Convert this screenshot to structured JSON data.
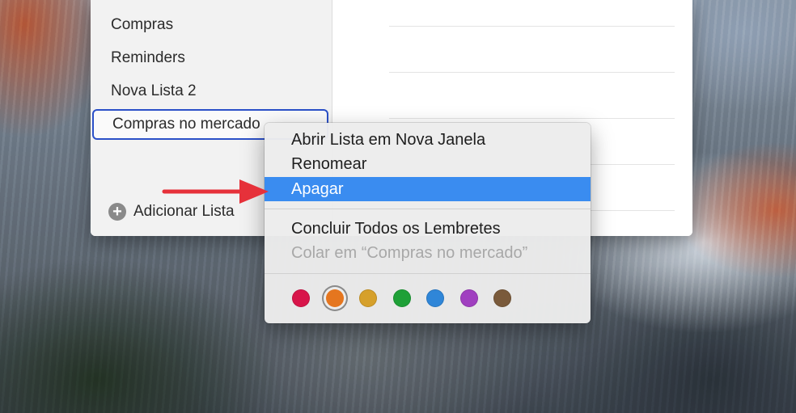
{
  "sidebar": {
    "items": [
      {
        "label": "Compras"
      },
      {
        "label": "Reminders"
      },
      {
        "label": "Nova Lista 2"
      },
      {
        "label": "Compras no mercado"
      }
    ],
    "add_list_label": "Adicionar Lista",
    "add_icon": "plus-circle-icon"
  },
  "context_menu": {
    "items": [
      {
        "label": "Abrir Lista em Nova Janela"
      },
      {
        "label": "Renomear"
      },
      {
        "label": "Apagar"
      },
      {
        "label": "Concluir Todos os Lembretes"
      },
      {
        "label": "Colar em “Compras no mercado”"
      }
    ],
    "colors": [
      "#d8154a",
      "#e5761f",
      "#d6a02b",
      "#1ea037",
      "#2f86d8",
      "#a03fc0",
      "#7a5a3b"
    ],
    "selected_color": "#e5761f",
    "highlight_color": "#3a8cf0"
  },
  "annotation": {
    "arrow_color": "#e6313a"
  }
}
